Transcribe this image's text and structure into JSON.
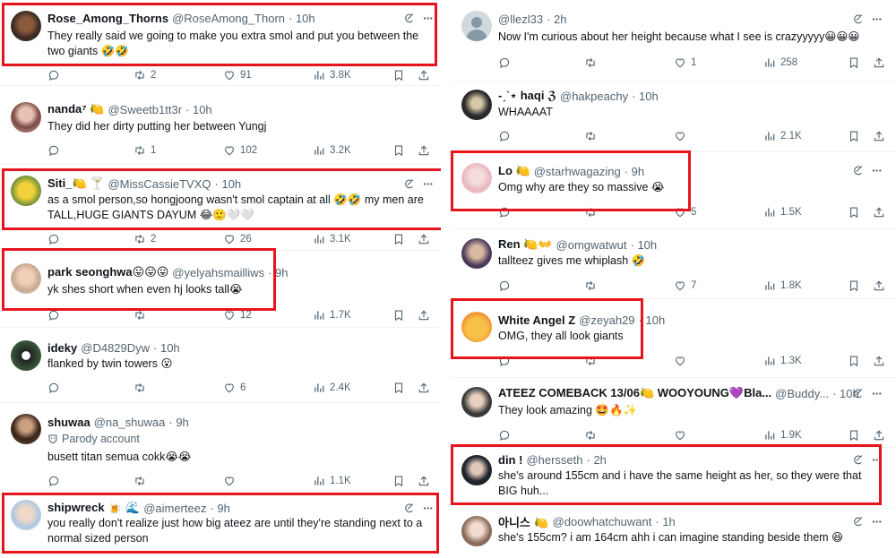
{
  "left_tweets": [
    {
      "name": "Rose_Among_Thorns",
      "handle": "@RoseAmong_Thorn",
      "time": "· 10h",
      "text": "They really said we going to make you extra smol and put you between the two giants 🤣🤣",
      "replies": "",
      "reposts": "2",
      "likes": "91",
      "views": "3.8K"
    },
    {
      "name": "nanda⁷ 🍋",
      "handle": "@Sweetb1tt3r",
      "time": "· 10h",
      "text": "They did her dirty putting her between Yungj",
      "replies": "",
      "reposts": "1",
      "likes": "102",
      "views": "3.2K"
    },
    {
      "name": "Siti_🍋 🍸",
      "handle": "@MissCassieTVXQ",
      "time": "· 10h",
      "text": "as a smol person,so hongjoong wasn't smol captain at all 🤣🤣 my men are TALL,HUGE GIANTS DAYUM 😂🙂🤍🤍",
      "replies": "",
      "reposts": "2",
      "likes": "26",
      "views": "3.1K"
    },
    {
      "name": "park seonghwa😛😛😛",
      "handle": "@yelyahsmailliws",
      "time": "· 9h",
      "text": "yk shes short when even hj looks tall😭",
      "replies": "",
      "reposts": "",
      "likes": "12",
      "views": "1.7K"
    },
    {
      "name": "ideky",
      "handle": "@D4829Dyw",
      "time": "· 10h",
      "text": "flanked by twin towers 😮",
      "replies": "",
      "reposts": "",
      "likes": "6",
      "views": "2.4K"
    },
    {
      "name": "shuwaa",
      "handle": "@na_shuwaa",
      "time": "· 9h",
      "subtitle": "Parody account",
      "text": "busett titan semua cokk😭😭",
      "replies": "",
      "reposts": "",
      "likes": "",
      "views": "1.1K"
    },
    {
      "name": "shipwreck 🍺 🌊",
      "handle": "@aimerteez",
      "time": "· 9h",
      "text": "you really don't realize just how big ateez are until they're standing next to a normal sized person"
    }
  ],
  "right_tweets": [
    {
      "name": "",
      "handle": "@llezl33",
      "time": "· 2h",
      "text": "Now I'm curious about her height because what I see is crazyyyyy😀😀😀",
      "replies": "",
      "reposts": "",
      "likes": "1",
      "views": "258"
    },
    {
      "name": "-ˏˋ⋆ haqi ℨ",
      "handle": "@hakpeachy",
      "time": "· 10h",
      "text": "WHAAAAT",
      "replies": "",
      "reposts": "",
      "likes": "",
      "views": "2.1K"
    },
    {
      "name": "Lo 🍋",
      "handle": "@starhwagazing",
      "time": "· 9h",
      "text": "Omg why are they so massive 😭",
      "replies": "",
      "reposts": "",
      "likes": "5",
      "views": "1.5K"
    },
    {
      "name": "Ren 🍋👐",
      "handle": "@omgwatwut",
      "time": "· 10h",
      "text": "tallteez gives me whiplash 🤣",
      "replies": "",
      "reposts": "",
      "likes": "7",
      "views": "1.8K"
    },
    {
      "name": "White Angel Z",
      "handle": "@zeyah29",
      "time": "· 10h",
      "text": "OMG, they all look giants",
      "replies": "",
      "reposts": "",
      "likes": "",
      "views": "1.3K"
    },
    {
      "name": "ATEEZ COMEBACK 13/06🍋 WOOYOUNG💜Bla...",
      "handle": "@Buddy...",
      "time": "· 10h",
      "text": "They look amazing 🤩🔥✨",
      "replies": "",
      "reposts": "",
      "likes": "",
      "views": "1.9K"
    },
    {
      "name": "din !",
      "handle": "@hersseth",
      "time": "· 2h",
      "text": "she's around 155cm and i have the same height as her, so they were that BIG huh..."
    },
    {
      "name": "아니스 🍋",
      "handle": "@doowhatchuwant",
      "time": "· 1h",
      "text": "she's 155cm? i am 164cm ahh i can imagine standing beside them 😆"
    }
  ],
  "colors": {
    "highlight_border": "#e8141d",
    "text_primary": "#0f1419",
    "text_secondary": "#536471",
    "divider": "#eff3f4"
  },
  "icons": [
    "grok-icon",
    "more-icon",
    "reply-icon",
    "repost-icon",
    "like-icon",
    "views-icon",
    "bookmark-icon",
    "share-icon",
    "parody-icon"
  ]
}
